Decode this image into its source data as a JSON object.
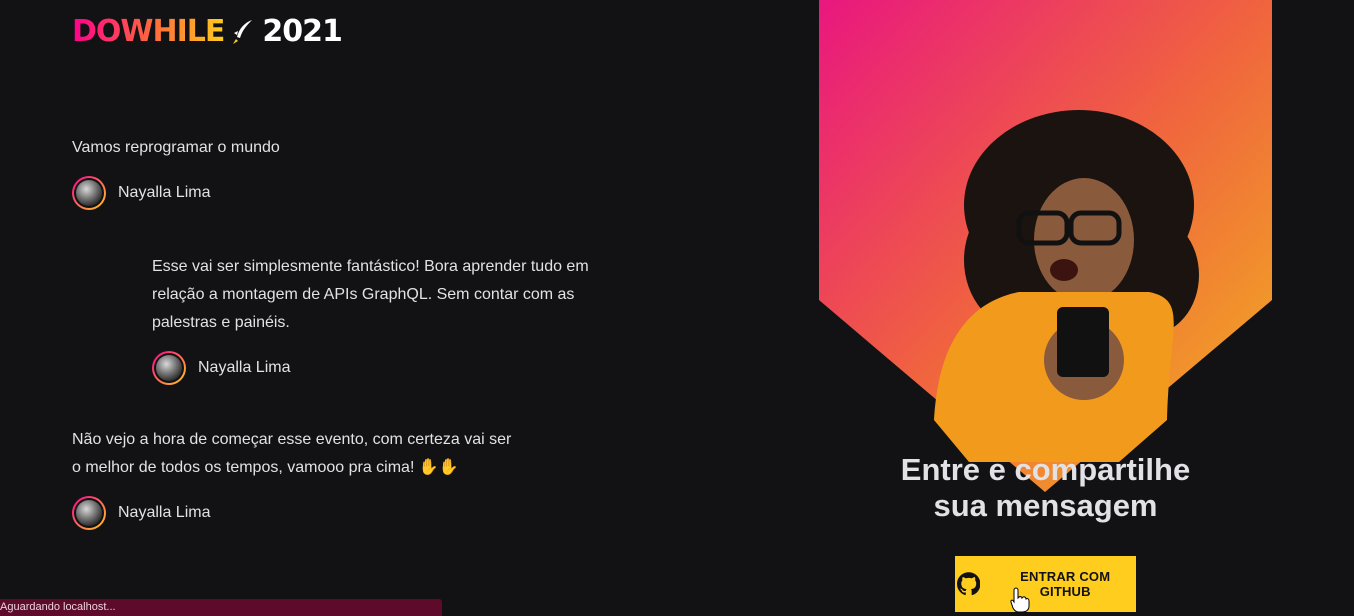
{
  "logo": {
    "brand": "DOWHILE",
    "year": "2021"
  },
  "messages": [
    {
      "text_lines": [
        "Vamos reprogramar o mundo"
      ],
      "author": "Nayalla Lima"
    },
    {
      "text_lines": [
        "Esse vai ser simplesmente fantástico! Bora aprender tudo em",
        "relação a montagem de APIs GraphQL. Sem contar com as",
        "palestras e painéis."
      ],
      "author": "Nayalla Lima"
    },
    {
      "text_lines": [
        "Não vejo a hora de começar esse evento, com certeza vai ser",
        "o melhor de todos os tempos, vamooo pra cima! ✋✋"
      ],
      "author": "Nayalla Lima"
    }
  ],
  "banner": {
    "title_line1": "Entre e compartilhe",
    "title_line2": "sua mensagem",
    "button_label": "ENTRAR COM GITHUB",
    "button_icon": "github-icon"
  },
  "status_bar": {
    "text": "Aguardando localhost..."
  },
  "colors": {
    "background": "#121214",
    "accent_pink": "#ff008e",
    "accent_yellow": "#ffcd1e",
    "text": "#e1e1e6"
  }
}
